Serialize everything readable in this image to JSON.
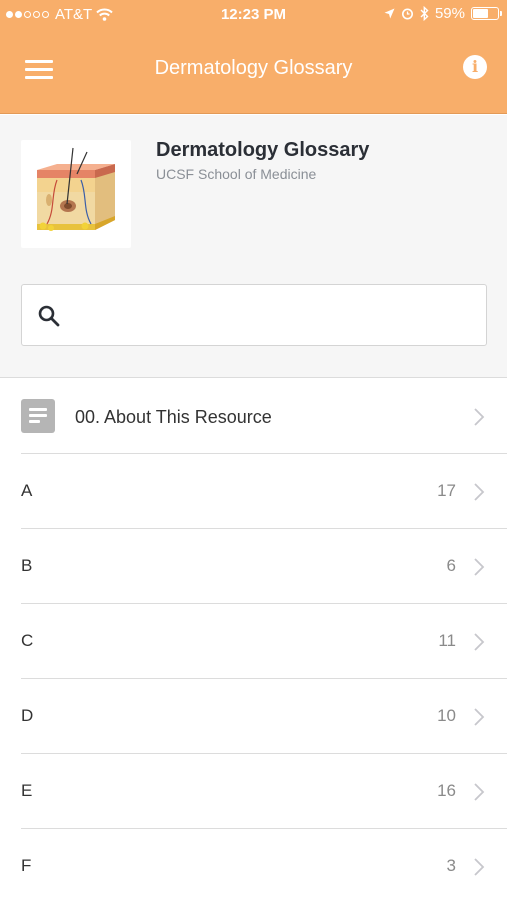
{
  "status_bar": {
    "carrier": "AT&T",
    "time": "12:23 PM",
    "battery": "59%",
    "battery_level": 0.59
  },
  "nav": {
    "title": "Dermatology Glossary"
  },
  "resource": {
    "title": "Dermatology Glossary",
    "subtitle": "UCSF School of Medicine"
  },
  "search": {
    "placeholder": "",
    "value": ""
  },
  "about": {
    "label": "00. About This Resource"
  },
  "sections": [
    {
      "letter": "A",
      "count": "17"
    },
    {
      "letter": "B",
      "count": "6"
    },
    {
      "letter": "C",
      "count": "11"
    },
    {
      "letter": "D",
      "count": "10"
    },
    {
      "letter": "E",
      "count": "16"
    },
    {
      "letter": "F",
      "count": "3"
    }
  ],
  "colors": {
    "accent": "#F8AE6A",
    "panel": "#F6F6F6",
    "divider": "#DCDCDC"
  }
}
